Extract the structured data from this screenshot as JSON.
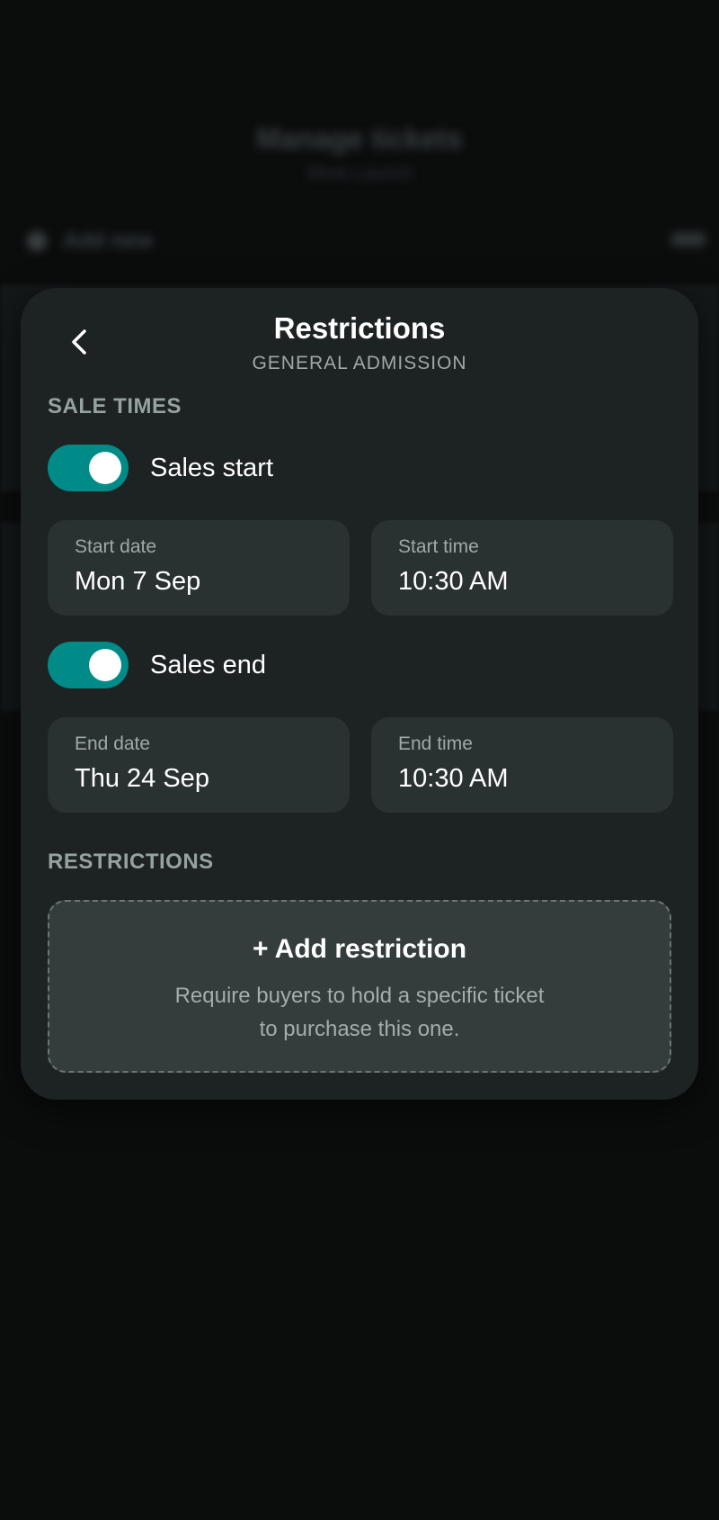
{
  "background": {
    "title": "Manage tickets",
    "subtitle": "Work Launch",
    "add_label": "Add new"
  },
  "sheet": {
    "title": "Restrictions",
    "subtitle": "GENERAL ADMISSION",
    "back_icon": "chevron-left-icon"
  },
  "sale_times": {
    "section_label": "SALE TIMES",
    "sales_start": {
      "label": "Sales start",
      "enabled": true,
      "date_label": "Start date",
      "date_value": "Mon 7 Sep",
      "time_label": "Start time",
      "time_value": "10:30 AM"
    },
    "sales_end": {
      "label": "Sales end",
      "enabled": true,
      "date_label": "End date",
      "date_value": "Thu 24 Sep",
      "time_label": "End time",
      "time_value": "10:30 AM"
    }
  },
  "restrictions": {
    "section_label": "RESTRICTIONS",
    "add_title": "+ Add restriction",
    "add_description": "Require buyers to hold a specific ticket to purchase this one."
  },
  "colors": {
    "accent": "#008a88",
    "sheet_bg": "#1d2222",
    "field_bg": "#2a3131",
    "page_bg": "#0b0d0d"
  }
}
